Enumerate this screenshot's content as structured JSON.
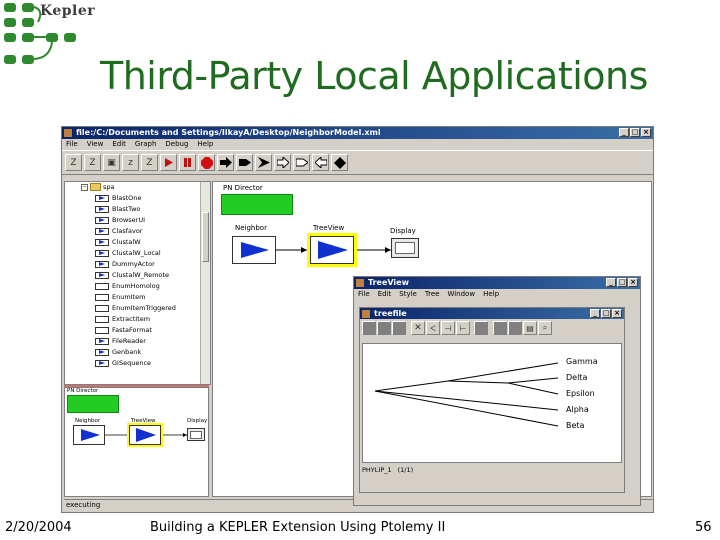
{
  "slide": {
    "logo": "Kepler",
    "title": "Third-Party Local Applications",
    "footer_date": "2/20/2004",
    "footer_center": "Building a KEPLER Extension Using Ptolemy II",
    "footer_page": "56"
  },
  "main_window": {
    "title": "file:/C:/Documents and Settings/IlkayA/Desktop/NeighborModel.xml",
    "menu": [
      "File",
      "View",
      "Edit",
      "Graph",
      "Debug",
      "Help"
    ],
    "tree_root": "spa",
    "tree_items": [
      "BlastOne",
      "BlastTwo",
      "BrowserUI",
      "Clasfavor",
      "ClustalW",
      "ClustalW_Local",
      "DummyActor",
      "ClustalW_Remote",
      "EnumHomolog",
      "EnumItem",
      "EnumItemTriggered",
      "ExtractItem",
      "FastaFormat",
      "FileReader",
      "Genbank",
      "GISequence"
    ],
    "canvas": {
      "director": "PN Director",
      "actor_neighbor": "Neighbor",
      "actor_treeview": "TreeView",
      "actor_display": "Display"
    },
    "overview": {
      "director": "PN Director",
      "actor_neighbor": "Neighbor",
      "actor_treeview": "TreeView",
      "actor_display": "Display"
    },
    "status": "executing",
    "director_color": "#22cc22",
    "highlight_color": "#ffff00"
  },
  "treeview_window": {
    "title": "TreeView",
    "menu": [
      "File",
      "Edit",
      "Style",
      "Tree",
      "Window",
      "Help"
    ],
    "inner_title": "treefile",
    "leaves": [
      "Gamma",
      "Delta",
      "Epsilon",
      "Alpha",
      "Beta"
    ],
    "status": "PHYLIP_1",
    "status_count": "(1/1)"
  }
}
